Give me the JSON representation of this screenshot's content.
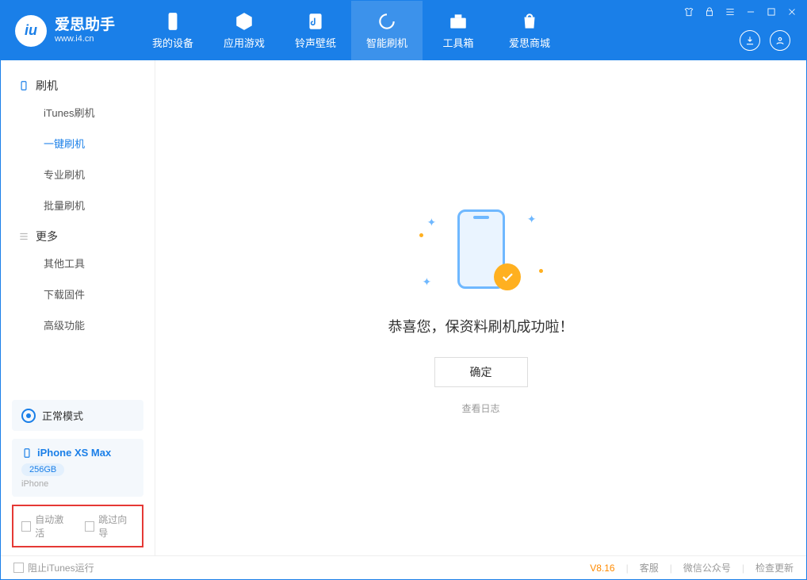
{
  "app": {
    "title": "爱思助手",
    "subtitle": "www.i4.cn"
  },
  "nav": {
    "items": [
      {
        "label": "我的设备"
      },
      {
        "label": "应用游戏"
      },
      {
        "label": "铃声壁纸"
      },
      {
        "label": "智能刷机"
      },
      {
        "label": "工具箱"
      },
      {
        "label": "爱思商城"
      }
    ]
  },
  "sidebar": {
    "group1": "刷机",
    "items1": [
      "iTunes刷机",
      "一键刷机",
      "专业刷机",
      "批量刷机"
    ],
    "group2": "更多",
    "items2": [
      "其他工具",
      "下载固件",
      "高级功能"
    ],
    "mode": "正常模式",
    "device": {
      "name": "iPhone XS Max",
      "storage": "256GB",
      "type": "iPhone"
    },
    "opts": {
      "auto_activate": "自动激活",
      "skip_guide": "跳过向导"
    }
  },
  "main": {
    "success_text": "恭喜您，保资料刷机成功啦！",
    "ok": "确定",
    "view_log": "查看日志"
  },
  "footer": {
    "block_itunes": "阻止iTunes运行",
    "version": "V8.16",
    "links": [
      "客服",
      "微信公众号",
      "检查更新"
    ]
  }
}
